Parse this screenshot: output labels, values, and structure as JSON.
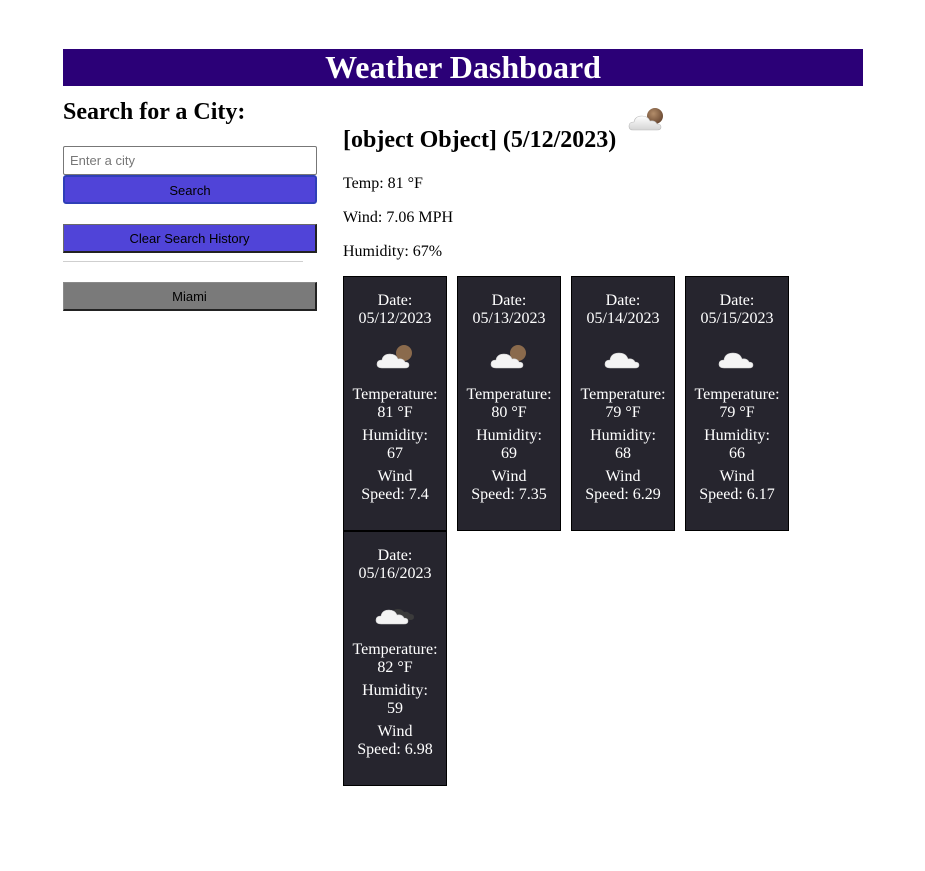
{
  "header": {
    "title": "Weather Dashboard"
  },
  "sidebar": {
    "heading": "Search for a City:",
    "input_placeholder": "Enter a city",
    "search_label": "Search",
    "clear_label": "Clear Search History",
    "history": [
      "Miami"
    ]
  },
  "current": {
    "title": "[object Object] (5/12/2023)",
    "icon": "partly-cloudy-night-icon",
    "temp": "Temp: 81 °F",
    "wind": "Wind: 7.06 MPH",
    "humidity": "Humidity: 67%"
  },
  "forecast": [
    {
      "date_label": "Date:",
      "date": "05/12/2023",
      "icon": "partly-cloudy-night-icon",
      "temp_label": "Temperature:",
      "temp": "81 °F",
      "hum_label": "Humidity:",
      "humidity": "67",
      "wind_label": "Wind",
      "wind": "Speed: 7.4"
    },
    {
      "date_label": "Date:",
      "date": "05/13/2023",
      "icon": "partly-cloudy-night-icon",
      "temp_label": "Temperature:",
      "temp": "80 °F",
      "hum_label": "Humidity:",
      "humidity": "69",
      "wind_label": "Wind",
      "wind": "Speed: 7.35"
    },
    {
      "date_label": "Date:",
      "date": "05/14/2023",
      "icon": "cloud-icon",
      "temp_label": "Temperature:",
      "temp": "79 °F",
      "hum_label": "Humidity:",
      "humidity": "68",
      "wind_label": "Wind",
      "wind": "Speed: 6.29"
    },
    {
      "date_label": "Date:",
      "date": "05/15/2023",
      "icon": "cloud-icon",
      "temp_label": "Temperature:",
      "temp": "79 °F",
      "hum_label": "Humidity:",
      "humidity": "66",
      "wind_label": "Wind",
      "wind": "Speed: 6.17"
    },
    {
      "date_label": "Date:",
      "date": "05/16/2023",
      "icon": "broken-clouds-icon",
      "temp_label": "Temperature:",
      "temp": "82 °F",
      "hum_label": "Humidity:",
      "humidity": "59",
      "wind_label": "Wind",
      "wind": "Speed: 6.98"
    }
  ],
  "colors": {
    "header_bg": "#2b0077",
    "button_accent": "#5044d8",
    "history_button": "#7a7a7a",
    "card_bg": "#26252e"
  }
}
